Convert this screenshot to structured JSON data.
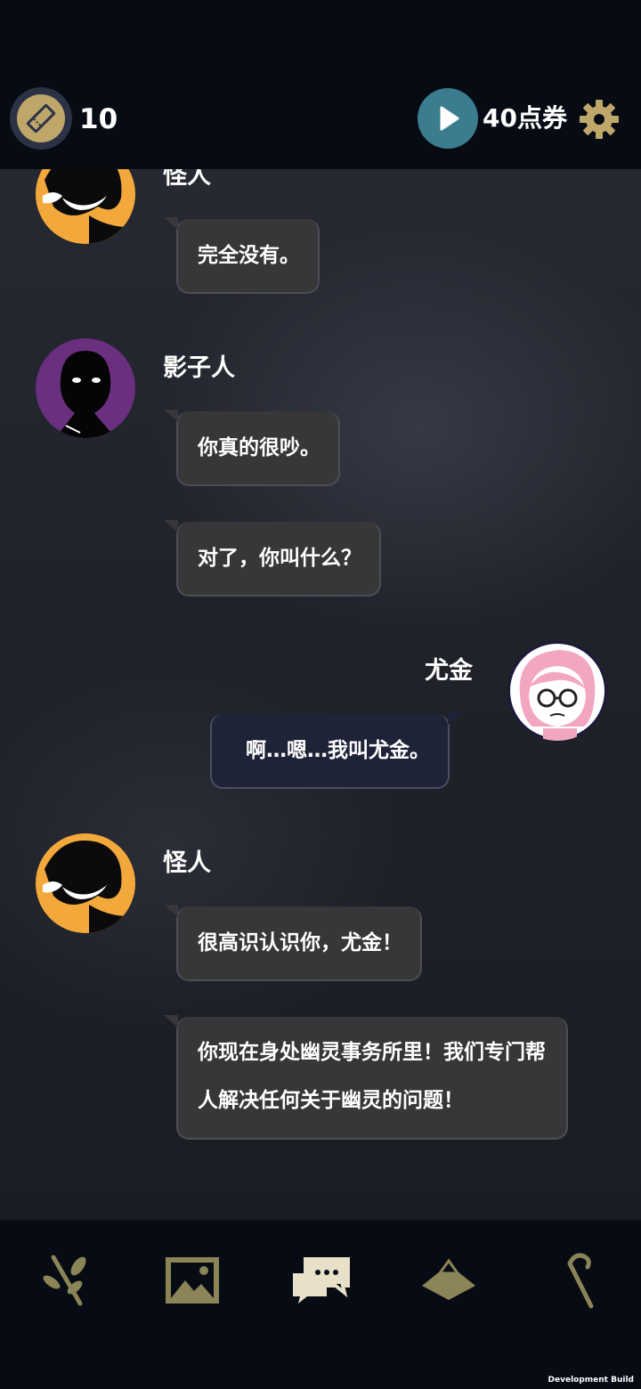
{
  "header": {
    "ticket_count": "10",
    "points_label": "40点券",
    "ticket_icon": "ticket-icon",
    "play_icon": "play-icon",
    "settings_icon": "gear-icon"
  },
  "chat": {
    "messages": [
      {
        "speaker": "怪人",
        "text": "完全没有。"
      },
      {
        "speaker": "影子人",
        "text": "你真的很吵。"
      },
      {
        "text": "对了，你叫什么？"
      },
      {
        "speaker": "尤金",
        "text": "啊…嗯…我叫尤金。"
      },
      {
        "speaker": "怪人",
        "text": "很高识认识你，尤金！"
      },
      {
        "text": "你现在身处幽灵事务所里！我们专门帮人解决任何关于幽灵的问题！"
      }
    ]
  },
  "nav": {
    "items": [
      {
        "icon": "branch-icon"
      },
      {
        "icon": "picture-icon"
      },
      {
        "icon": "chat-icon"
      },
      {
        "icon": "hat-icon"
      },
      {
        "icon": "cane-icon"
      }
    ]
  },
  "footer": {
    "dev_build": "Development Build"
  },
  "colors": {
    "background": "#070b14",
    "bubble": "#373739",
    "bubble_player": "#1f2338",
    "accent_gold": "#bfa76a",
    "play_teal": "#3b7d8f",
    "ghost_purple": "#6a2f7e",
    "weirdo_orange": "#f3a83c"
  }
}
